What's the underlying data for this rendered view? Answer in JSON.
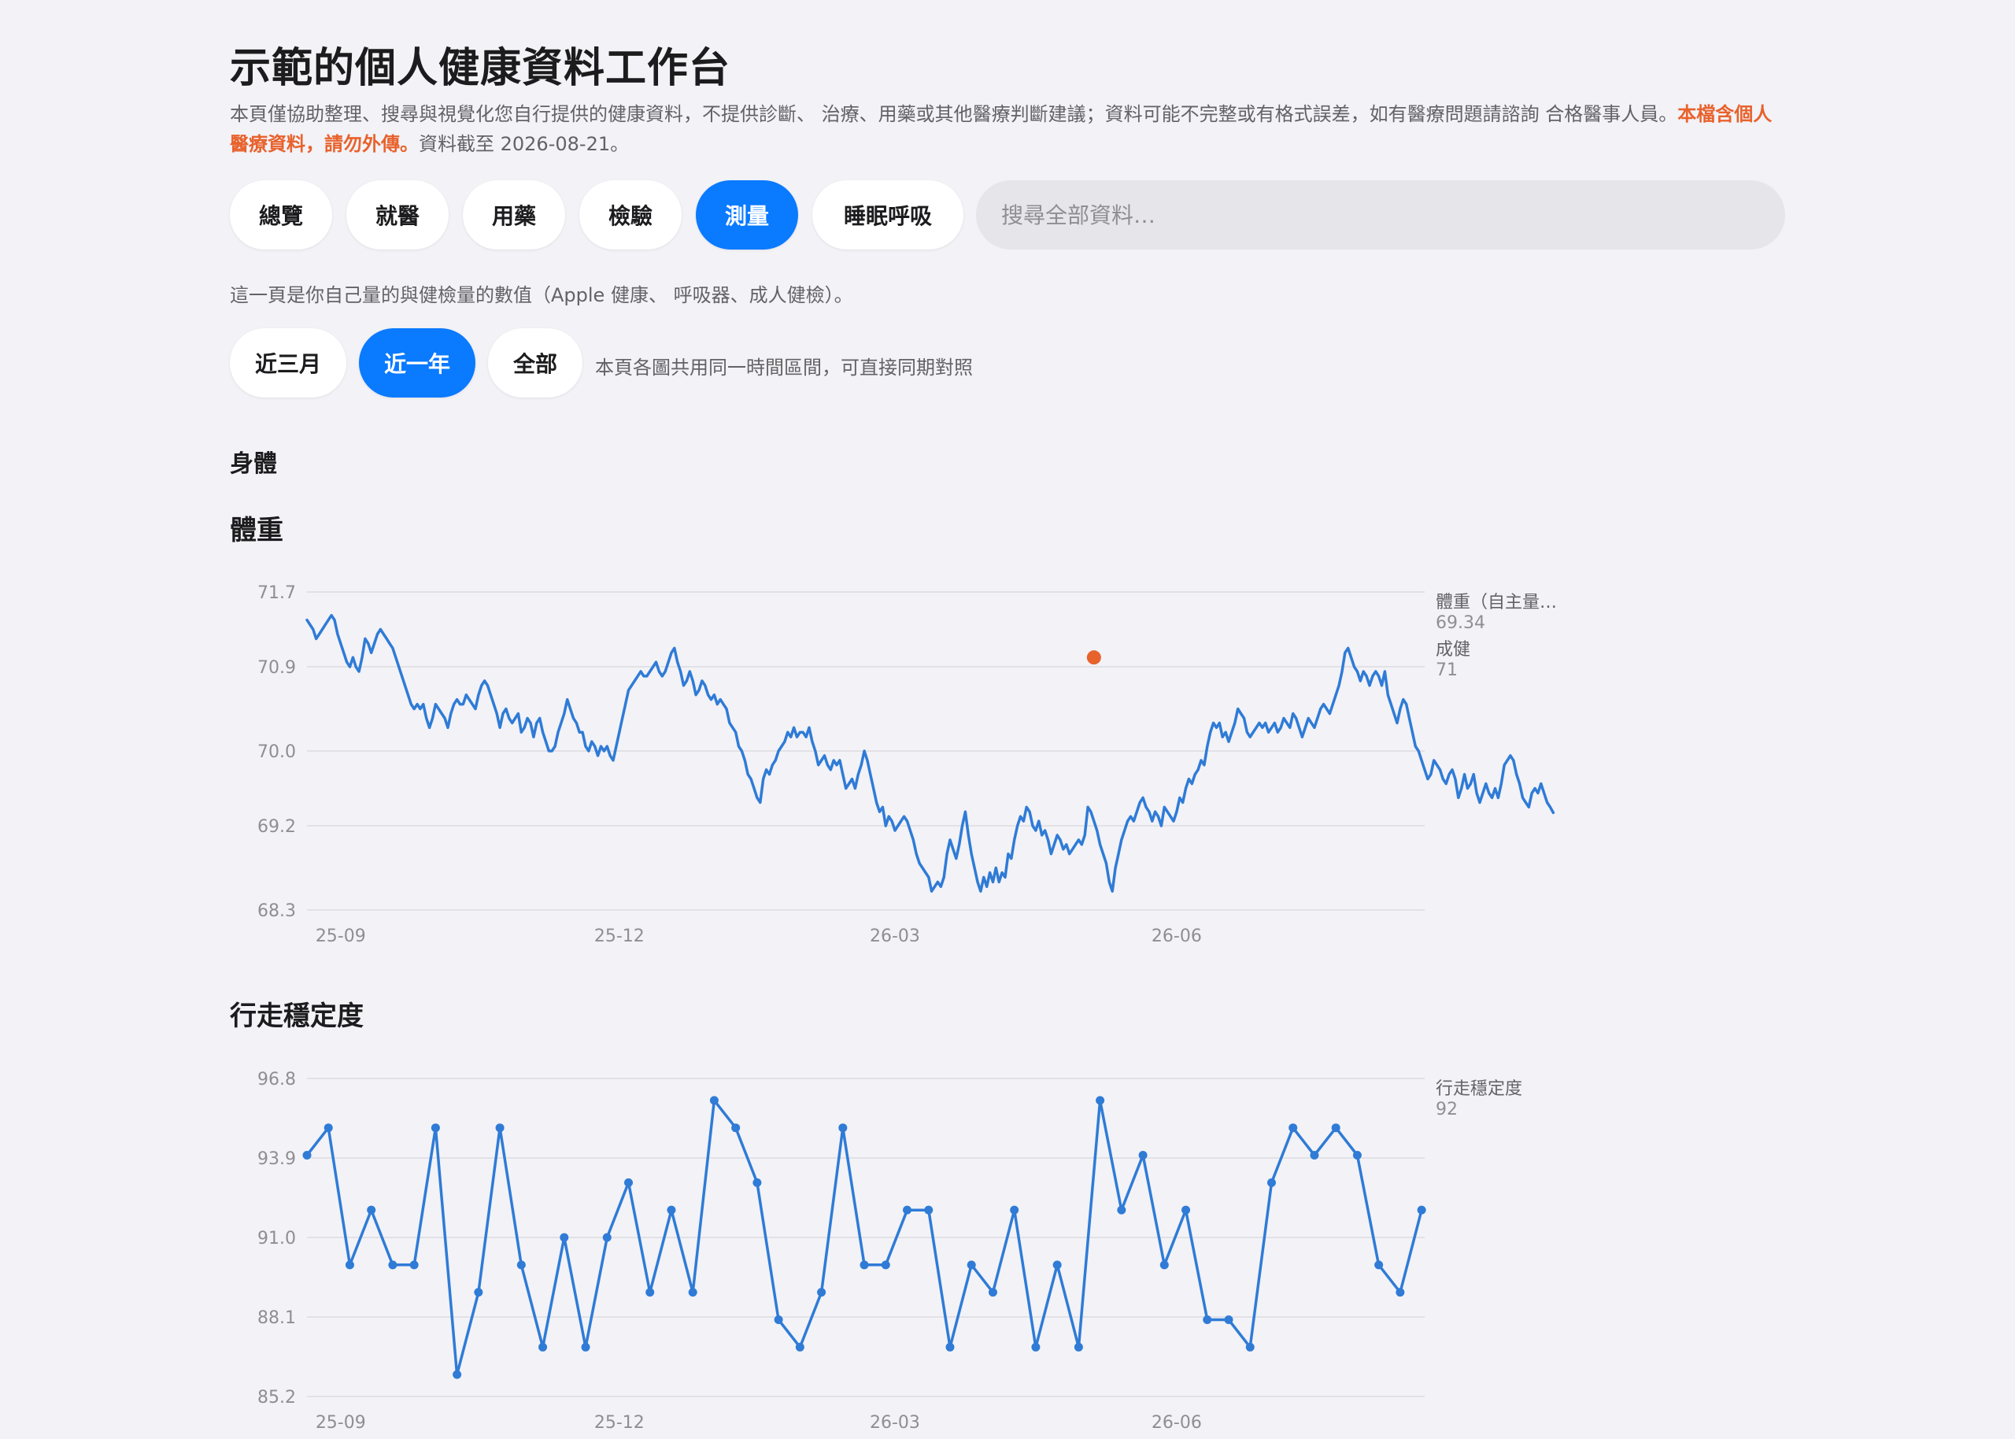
{
  "page": {
    "title": "示範的個人健康資料工作台",
    "notice": "本頁僅協助整理、搜尋與視覺化您自行提供的健康資料，不提供診斷、 治療、用藥或其他醫療判斷建議；資料可能不完整或有格式誤差，如有醫療問題請諮詢 合格醫事人員。",
    "notice_warning": "本檔含個人醫療資料，請勿外傳。",
    "as_of": "資料截至 2026-08-21。"
  },
  "tabs": [
    {
      "label": "總覽",
      "active": false
    },
    {
      "label": "就醫",
      "active": false
    },
    {
      "label": "用藥",
      "active": false
    },
    {
      "label": "檢驗",
      "active": false
    },
    {
      "label": "測量",
      "active": true
    },
    {
      "label": "睡眠呼吸",
      "active": false
    }
  ],
  "search": {
    "placeholder": "搜尋全部資料…",
    "value": ""
  },
  "measure_description": "這一頁是你自己量的與健檢量的數值（Apple 健康、 呼吸器、成人健檢）。",
  "range_filters": [
    {
      "label": "近三月",
      "active": false
    },
    {
      "label": "近一年",
      "active": true
    },
    {
      "label": "全部",
      "active": false
    }
  ],
  "range_note": "本頁各圖共用同一時間區間，可直接同期對照",
  "section": {
    "title": "身體"
  },
  "colors": {
    "primary": "#0a7aff",
    "line": "#2f7bd6",
    "checkup": "#e8622c",
    "warning": "#e8622c"
  },
  "chart_data": [
    {
      "type": "line",
      "title": "體重",
      "x_range": [
        "2025-08-21",
        "2026-08-21"
      ],
      "xticks": [
        {
          "date": "2025-09-01",
          "label": "25-09"
        },
        {
          "date": "2025-12-01",
          "label": "25-12"
        },
        {
          "date": "2026-03-01",
          "label": "26-03"
        },
        {
          "date": "2026-06-01",
          "label": "26-06"
        }
      ],
      "yticks": [
        "68.3",
        "69.2",
        "70.0",
        "70.9",
        "71.7"
      ],
      "ylim": [
        68.3,
        71.7
      ],
      "grid": true,
      "series": [
        {
          "name": "體重（自主量…",
          "last_value": "69.34",
          "style": "line",
          "start_date": "2025-08-21",
          "step_days": 1,
          "values": [
            71.4,
            71.35,
            71.3,
            71.2,
            71.25,
            71.3,
            71.35,
            71.4,
            71.45,
            71.4,
            71.25,
            71.15,
            71.05,
            70.95,
            70.9,
            71.0,
            70.9,
            70.85,
            71.0,
            71.2,
            71.15,
            71.05,
            71.15,
            71.25,
            71.3,
            71.25,
            71.2,
            71.15,
            71.1,
            71.0,
            70.9,
            70.8,
            70.7,
            70.6,
            70.5,
            70.45,
            70.5,
            70.45,
            70.5,
            70.35,
            70.25,
            70.35,
            70.5,
            70.45,
            70.4,
            70.35,
            70.25,
            70.4,
            70.5,
            70.55,
            70.5,
            70.5,
            70.6,
            70.55,
            70.5,
            70.45,
            70.6,
            70.7,
            70.75,
            70.7,
            70.6,
            70.5,
            70.4,
            70.25,
            70.4,
            70.45,
            70.35,
            70.3,
            70.35,
            70.4,
            70.2,
            70.25,
            70.35,
            70.3,
            70.15,
            70.3,
            70.35,
            70.2,
            70.1,
            70.0,
            70.0,
            70.05,
            70.2,
            70.3,
            70.4,
            70.55,
            70.45,
            70.35,
            70.3,
            70.2,
            70.2,
            70.05,
            70.0,
            70.1,
            70.05,
            69.95,
            70.05,
            70.0,
            70.05,
            69.95,
            69.9,
            70.05,
            70.2,
            70.35,
            70.5,
            70.65,
            70.7,
            70.75,
            70.8,
            70.85,
            70.8,
            70.8,
            70.85,
            70.9,
            70.95,
            70.85,
            70.8,
            70.85,
            70.95,
            71.05,
            71.1,
            70.95,
            70.85,
            70.7,
            70.75,
            70.85,
            70.75,
            70.6,
            70.65,
            70.75,
            70.7,
            70.6,
            70.55,
            70.6,
            70.5,
            70.55,
            70.5,
            70.45,
            70.3,
            70.25,
            70.2,
            70.05,
            70.0,
            69.9,
            69.75,
            69.7,
            69.6,
            69.5,
            69.45,
            69.7,
            69.8,
            69.75,
            69.85,
            69.9,
            70.0,
            70.05,
            70.1,
            70.2,
            70.15,
            70.25,
            70.15,
            70.2,
            70.2,
            70.15,
            70.25,
            70.1,
            70.0,
            69.85,
            69.9,
            69.95,
            69.85,
            69.8,
            69.9,
            69.85,
            69.9,
            69.75,
            69.6,
            69.65,
            69.7,
            69.6,
            69.75,
            69.85,
            70.0,
            69.9,
            69.75,
            69.6,
            69.45,
            69.35,
            69.4,
            69.2,
            69.3,
            69.25,
            69.15,
            69.2,
            69.25,
            69.3,
            69.25,
            69.15,
            69.05,
            68.9,
            68.8,
            68.75,
            68.7,
            68.65,
            68.5,
            68.55,
            68.6,
            68.55,
            68.65,
            68.9,
            69.05,
            68.95,
            68.85,
            69.0,
            69.2,
            69.35,
            69.1,
            68.9,
            68.75,
            68.6,
            68.5,
            68.65,
            68.55,
            68.7,
            68.6,
            68.75,
            68.6,
            68.7,
            68.65,
            68.9,
            68.85,
            69.05,
            69.2,
            69.3,
            69.25,
            69.4,
            69.35,
            69.2,
            69.15,
            69.25,
            69.1,
            69.15,
            69.05,
            68.9,
            69.0,
            69.1,
            69.05,
            68.95,
            69.0,
            68.9,
            68.95,
            69.0,
            69.05,
            69.0,
            69.1,
            69.4,
            69.35,
            69.25,
            69.15,
            69.0,
            68.9,
            68.8,
            68.6,
            68.5,
            68.75,
            68.9,
            69.05,
            69.15,
            69.25,
            69.3,
            69.25,
            69.35,
            69.45,
            69.5,
            69.4,
            69.35,
            69.25,
            69.35,
            69.3,
            69.2,
            69.4,
            69.35,
            69.3,
            69.25,
            69.35,
            69.5,
            69.45,
            69.6,
            69.7,
            69.65,
            69.75,
            69.8,
            69.9,
            69.85,
            70.05,
            70.2,
            70.3,
            70.25,
            70.3,
            70.15,
            70.2,
            70.1,
            70.2,
            70.3,
            70.45,
            70.4,
            70.35,
            70.2,
            70.15,
            70.2,
            70.25,
            70.3,
            70.25,
            70.3,
            70.2,
            70.25,
            70.3,
            70.2,
            70.25,
            70.35,
            70.3,
            70.25,
            70.4,
            70.35,
            70.25,
            70.15,
            70.25,
            70.35,
            70.3,
            70.25,
            70.35,
            70.45,
            70.5,
            70.45,
            70.4,
            70.5,
            70.6,
            70.7,
            70.85,
            71.05,
            71.1,
            71.0,
            70.9,
            70.85,
            70.75,
            70.85,
            70.8,
            70.7,
            70.8,
            70.85,
            70.8,
            70.7,
            70.85,
            70.6,
            70.5,
            70.4,
            70.3,
            70.45,
            70.55,
            70.5,
            70.35,
            70.2,
            70.05,
            70.0,
            69.9,
            69.8,
            69.7,
            69.75,
            69.9,
            69.85,
            69.8,
            69.7,
            69.65,
            69.75,
            69.8,
            69.7,
            69.5,
            69.6,
            69.75,
            69.6,
            69.65,
            69.75,
            69.55,
            69.45,
            69.55,
            69.65,
            69.55,
            69.5,
            69.6,
            69.5,
            69.65,
            69.85,
            69.9,
            69.95,
            69.9,
            69.75,
            69.65,
            69.5,
            69.45,
            69.4,
            69.55,
            69.6,
            69.55,
            69.65,
            69.55,
            69.45,
            69.4,
            69.34
          ]
        },
        {
          "name": "成健",
          "last_value": "71",
          "style": "point",
          "points": [
            {
              "date": "2026-05-05",
              "value": 71.0
            }
          ]
        }
      ]
    },
    {
      "type": "line",
      "title": "行走穩定度",
      "x_range": [
        "2025-08-21",
        "2026-08-21"
      ],
      "xticks": [
        {
          "date": "2025-09-01",
          "label": "25-09"
        },
        {
          "date": "2025-12-01",
          "label": "25-12"
        },
        {
          "date": "2026-03-01",
          "label": "26-03"
        },
        {
          "date": "2026-06-01",
          "label": "26-06"
        }
      ],
      "yticks": [
        "85.2",
        "88.1",
        "91.0",
        "93.9",
        "96.8"
      ],
      "ylim": [
        85.2,
        96.8
      ],
      "grid": true,
      "series": [
        {
          "name": "行走穩定度",
          "last_value": "92",
          "style": "line-markers",
          "start_date": "2025-08-21",
          "step_days": 7,
          "values": [
            94,
            95,
            90,
            92,
            90,
            90,
            95,
            86,
            89,
            95,
            90,
            87,
            91,
            87,
            91,
            93,
            89,
            92,
            89,
            96,
            95,
            93,
            88,
            87,
            89,
            95,
            90,
            90,
            92,
            92,
            87,
            90,
            89,
            92,
            87,
            90,
            87,
            96,
            92,
            94,
            90,
            92,
            88,
            88,
            87,
            93,
            95,
            94,
            95,
            94,
            90,
            89,
            92
          ]
        }
      ]
    }
  ]
}
